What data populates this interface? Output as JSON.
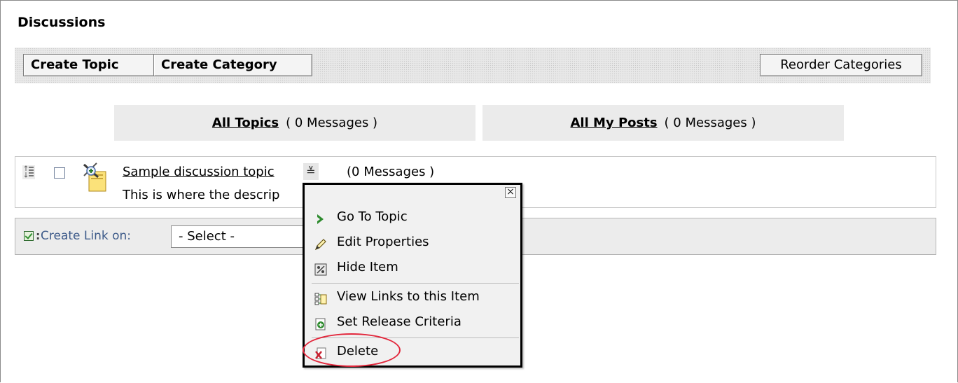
{
  "page": {
    "title": "Discussions"
  },
  "toolbar": {
    "create_topic": "Create Topic",
    "create_category": "Create Category",
    "reorder_categories": "Reorder Categories"
  },
  "summary": {
    "all_topics_link": "All Topics",
    "all_topics_count": "( 0 Messages )",
    "all_my_posts_link": "All My Posts",
    "all_my_posts_count": "( 0 Messages )"
  },
  "topic": {
    "title": "Sample discussion topic",
    "count": "(0 Messages )",
    "description": "This is where the descrip",
    "context_trigger_glyph": "≚"
  },
  "link_bar": {
    "label": "Create Link on:",
    "select_value": "- Select -"
  },
  "context_menu": {
    "close_glyph": "×",
    "items": [
      {
        "label": "Go To Topic",
        "icon": "go-arrow-icon"
      },
      {
        "label": "Edit Properties",
        "icon": "pencil-icon"
      },
      {
        "label": "Hide Item",
        "icon": "hide-icon"
      },
      {
        "label": "View Links to this Item",
        "icon": "links-icon"
      },
      {
        "label": "Set Release Criteria",
        "icon": "release-criteria-icon"
      },
      {
        "label": "Delete",
        "icon": "delete-icon"
      }
    ],
    "highlight_color": "#e2263b"
  }
}
